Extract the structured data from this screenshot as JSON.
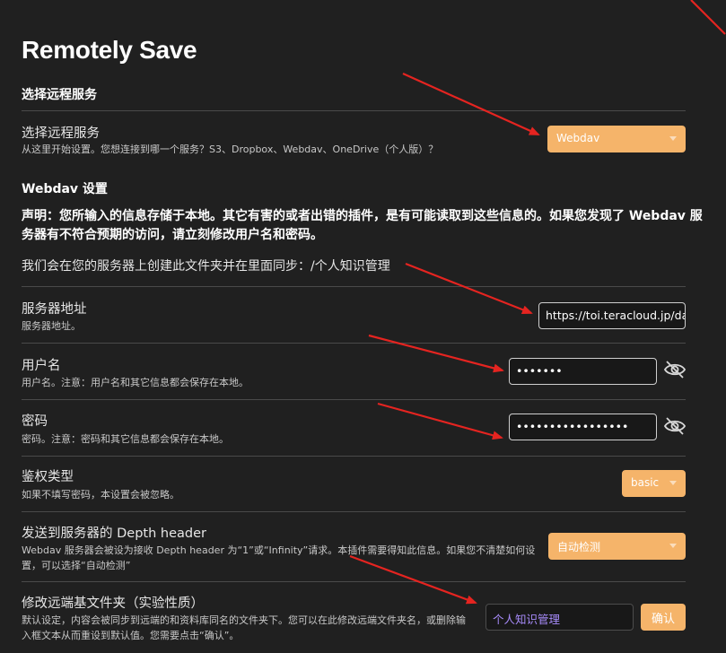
{
  "title": "Remotely Save",
  "service_section": {
    "heading": "选择远程服务",
    "setting_name": "选择远程服务",
    "setting_desc": "从这里开始设置。您想连接到哪一个服务？S3、Dropbox、Webdav、OneDrive（个人版）？",
    "selected": "Webdav"
  },
  "webdav_section": {
    "heading": "Webdav 设置",
    "warning": "声明：您所输入的信息存储于本地。其它有害的或者出错的插件，是有可能读取到这些信息的。如果您发现了 Webdav 服务器有不符合预期的访问，请立刻修改用户名和密码。",
    "folder_note": "我们会在您的服务器上创建此文件夹并在里面同步：/个人知识管理"
  },
  "server": {
    "name": "服务器地址",
    "desc": "服务器地址。",
    "value": "https://toi.teracloud.jp/da"
  },
  "username": {
    "name": "用户名",
    "desc": "用户名。注意：用户名和其它信息都会保存在本地。",
    "value": "•••••••"
  },
  "password": {
    "name": "密码",
    "desc": "密码。注意：密码和其它信息都会保存在本地。",
    "value": "•••••••••••••••••"
  },
  "auth": {
    "name": "鉴权类型",
    "desc": "如果不填写密码，本设置会被忽略。",
    "selected": "basic"
  },
  "depth": {
    "name": "发送到服务器的 Depth header",
    "desc": "Webdav 服务器会被设为接收 Depth header 为“1”或“Infinity”请求。本插件需要得知此信息。如果您不清楚如何设置，可以选择“自动检测”",
    "selected": "自动检测"
  },
  "remote_base": {
    "name": "修改远端基文件夹（实验性质）",
    "desc": "默认设定，内容会被同步到远端的和资料库同名的文件夹下。您可以在此修改远端文件夹名，或删除输入框文本从而重设到默认值。您需要点击“确认”。",
    "placeholder": "个人知识管理",
    "confirm_label": "确认"
  },
  "colors": {
    "background": "#202020",
    "accent": "#f5b46a",
    "annotation_arrow": "#e52420",
    "placeholder_text": "#a78bfa"
  },
  "icons": {
    "toggle_visibility": "eye-off-icon",
    "select_caret": "chevron-down-icon"
  }
}
